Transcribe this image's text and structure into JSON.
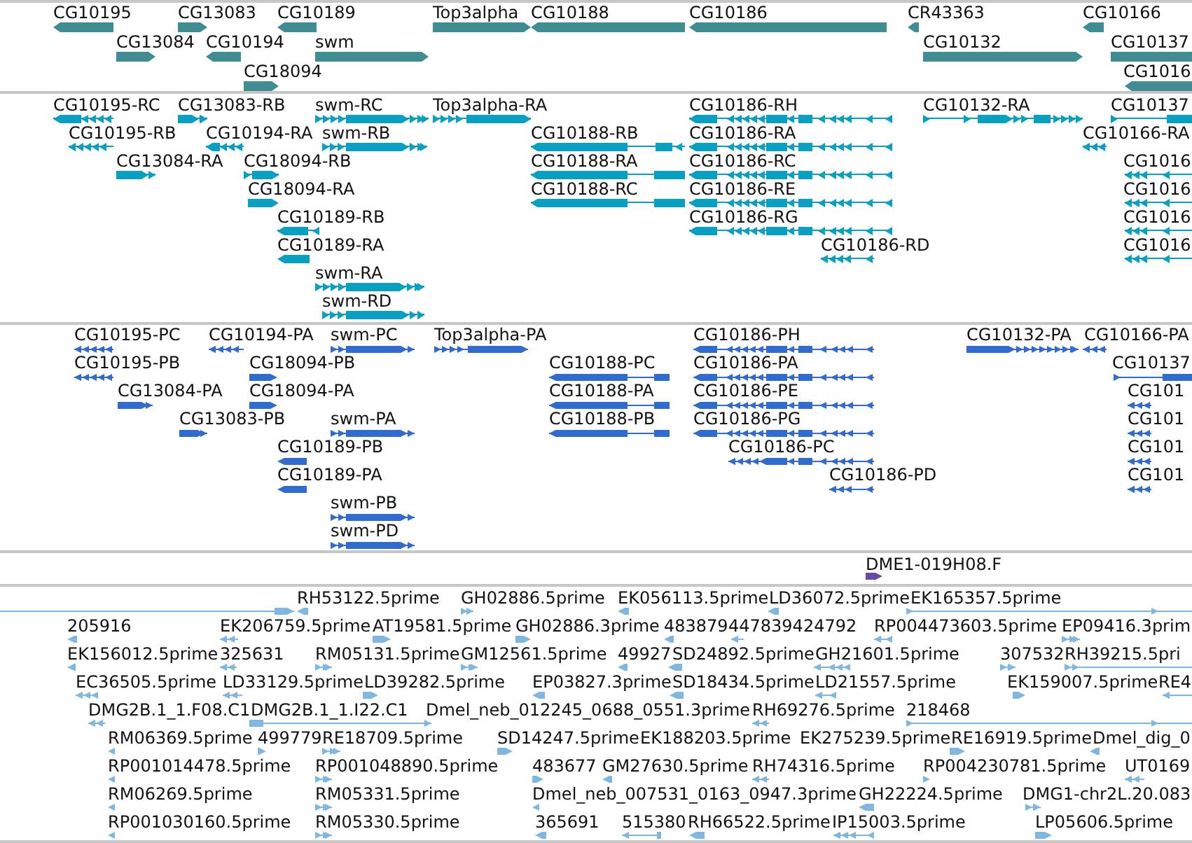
{
  "tracks": [
    {
      "kind": "gene",
      "color": "#3f8c92",
      "features": [
        {
          "label": "CG10195",
          "reverse": true
        },
        {
          "label": "CG13083",
          "reverse": false
        },
        {
          "label": "CG10189",
          "reverse": true
        },
        {
          "label": "Top3alpha",
          "reverse": false
        },
        {
          "label": "CG10188",
          "reverse": true
        },
        {
          "label": "CG10186",
          "reverse": true
        },
        {
          "label": "CR43363",
          "reverse": true
        },
        {
          "label": "CG10166",
          "reverse": true
        },
        {
          "label": "CG13084",
          "reverse": false
        },
        {
          "label": "CG10194",
          "reverse": true
        },
        {
          "label": "swm",
          "reverse": false
        },
        {
          "label": "CG10132",
          "reverse": false
        },
        {
          "label": "CG10137",
          "reverse": false
        },
        {
          "label": "CG18094",
          "reverse": false
        },
        {
          "label": "CG1016",
          "reverse": true
        }
      ]
    },
    {
      "kind": "transcript",
      "color": "#07a0c2",
      "features": [
        {
          "label": "CG10195-RC",
          "reverse": true
        },
        {
          "label": "CG13083-RB",
          "reverse": false
        },
        {
          "label": "swm-RC",
          "reverse": false
        },
        {
          "label": "Top3alpha-RA",
          "reverse": false
        },
        {
          "label": "CG10186-RH",
          "reverse": true
        },
        {
          "label": "CG10132-RA",
          "reverse": false
        },
        {
          "label": "CG10137",
          "reverse": false
        },
        {
          "label": "CG10195-RB",
          "reverse": true
        },
        {
          "label": "CG10194-RA",
          "reverse": true
        },
        {
          "label": "swm-RB",
          "reverse": false
        },
        {
          "label": "CG10188-RB",
          "reverse": true
        },
        {
          "label": "CG10186-RA",
          "reverse": true
        },
        {
          "label": "CG10166-RA",
          "reverse": true
        },
        {
          "label": "CG13084-RA",
          "reverse": false
        },
        {
          "label": "CG18094-RB",
          "reverse": false
        },
        {
          "label": "CG10188-RA",
          "reverse": true
        },
        {
          "label": "CG10186-RC",
          "reverse": true
        },
        {
          "label": "CG1016",
          "reverse": true
        },
        {
          "label": "CG18094-RA",
          "reverse": false
        },
        {
          "label": "CG10188-RC",
          "reverse": true
        },
        {
          "label": "CG10186-RE",
          "reverse": true
        },
        {
          "label": "CG1016",
          "reverse": true
        },
        {
          "label": "CG10189-RB",
          "reverse": true
        },
        {
          "label": "CG10186-RG",
          "reverse": true
        },
        {
          "label": "CG1016",
          "reverse": true
        },
        {
          "label": "CG10189-RA",
          "reverse": true
        },
        {
          "label": "CG10186-RD",
          "reverse": true
        },
        {
          "label": "CG1016",
          "reverse": true
        },
        {
          "label": "swm-RA",
          "reverse": false
        },
        {
          "label": "swm-RD",
          "reverse": false
        }
      ]
    },
    {
      "kind": "protein",
      "color": "#306bd0",
      "features": [
        {
          "label": "CG10195-PC",
          "reverse": true
        },
        {
          "label": "CG10194-PA",
          "reverse": true
        },
        {
          "label": "swm-PC",
          "reverse": false
        },
        {
          "label": "Top3alpha-PA",
          "reverse": false
        },
        {
          "label": "CG10186-PH",
          "reverse": true
        },
        {
          "label": "CG10132-PA",
          "reverse": false
        },
        {
          "label": "CG10166-PA",
          "reverse": true
        },
        {
          "label": "CG10195-PB",
          "reverse": true
        },
        {
          "label": "CG18094-PB",
          "reverse": false
        },
        {
          "label": "CG10188-PC",
          "reverse": true
        },
        {
          "label": "CG10186-PA",
          "reverse": true
        },
        {
          "label": "CG10137",
          "reverse": false
        },
        {
          "label": "CG13084-PA",
          "reverse": false
        },
        {
          "label": "CG18094-PA",
          "reverse": false
        },
        {
          "label": "CG10188-PA",
          "reverse": true
        },
        {
          "label": "CG10186-PE",
          "reverse": true
        },
        {
          "label": "CG101",
          "reverse": true
        },
        {
          "label": "CG13083-PB",
          "reverse": false
        },
        {
          "label": "swm-PA",
          "reverse": false
        },
        {
          "label": "CG10188-PB",
          "reverse": true
        },
        {
          "label": "CG10186-PG",
          "reverse": true
        },
        {
          "label": "CG101",
          "reverse": true
        },
        {
          "label": "CG10189-PB",
          "reverse": true
        },
        {
          "label": "CG10186-PC",
          "reverse": true
        },
        {
          "label": "CG101",
          "reverse": true
        },
        {
          "label": "CG10189-PA",
          "reverse": true
        },
        {
          "label": "CG10186-PD",
          "reverse": true
        },
        {
          "label": "CG101",
          "reverse": true
        },
        {
          "label": "swm-PB",
          "reverse": false
        },
        {
          "label": "swm-PD",
          "reverse": false
        }
      ]
    },
    {
      "kind": "clone",
      "color": "#6a4aa8",
      "features": [
        {
          "label": "DME1-019H08.F",
          "reverse": false
        }
      ]
    },
    {
      "kind": "est",
      "color": "#7db7e2",
      "features": [
        {
          "reverse": false
        },
        {
          "label": "RH53122.5prime",
          "reverse": true
        },
        {
          "label": "GH02886.5prime",
          "reverse": false
        },
        {
          "label": "EK056113.5prime",
          "reverse": true
        },
        {
          "label": "LD36072.5prime",
          "reverse": true
        },
        {
          "label": "EK165357.5prime",
          "reverse": false
        },
        {
          "label": "205916",
          "reverse": true
        },
        {
          "label": "EK206759.5prime",
          "reverse": true
        },
        {
          "label": "AT19581.5prime",
          "reverse": false
        },
        {
          "label": "GH02886.3prime",
          "reverse": false
        },
        {
          "label": "483879",
          "reverse": true
        },
        {
          "label": "447839424792",
          "reverse": true
        },
        {
          "label": "RP004473603.5prime",
          "reverse": true
        },
        {
          "label": "EP09416.3prim",
          "reverse": false
        },
        {
          "label": "EK156012.5prime",
          "reverse": true
        },
        {
          "label": "325631",
          "reverse": true
        },
        {
          "label": "RM05131.5prime",
          "reverse": false
        },
        {
          "label": "GM12561.5prime",
          "reverse": false
        },
        {
          "label": "49927",
          "reverse": true
        },
        {
          "label": "SD24892.5prime",
          "reverse": true
        },
        {
          "label": "GH21601.5prime",
          "reverse": true
        },
        {
          "label": "307532",
          "reverse": false
        },
        {
          "label": "RH39215.5pri",
          "reverse": false
        },
        {
          "label": "EC36505.5prime",
          "reverse": true
        },
        {
          "label": "LD33129.5prime",
          "reverse": true
        },
        {
          "label": "LD39282.5prime",
          "reverse": false
        },
        {
          "label": "EP03827.3prime",
          "reverse": true
        },
        {
          "label": "SD18434.5prime",
          "reverse": true
        },
        {
          "label": "LD21557.5prime",
          "reverse": true
        },
        {
          "label": "EK159007.5prime",
          "reverse": false
        },
        {
          "label": "RE4",
          "reverse": true
        },
        {
          "label": "DMG2B.1_1.F08.C1",
          "reverse": true
        },
        {
          "label": "DMG2B.1_1.I22.C1",
          "reverse": false
        },
        {
          "label": "Dmel_neb_012245_0688_0551.3prime"
        },
        {
          "label": "RH69276.5prime",
          "reverse": true
        },
        {
          "label": "218468",
          "reverse": false
        },
        {
          "label": "RM06369.5prime",
          "reverse": true
        },
        {
          "label": "499779",
          "reverse": false
        },
        {
          "label": "RE18709.5prime",
          "reverse": false
        },
        {
          "label": "SD14247.5prime",
          "reverse": false
        },
        {
          "label": "EK188203.5prime"
        },
        {
          "label": "EK275239.5prime"
        },
        {
          "label": "RE16919.5prime",
          "reverse": false
        },
        {
          "label": "Dmel_dig_0",
          "reverse": true
        },
        {
          "label": "RP001014478.5prime",
          "reverse": true
        },
        {
          "label": "RP001048890.5prime",
          "reverse": false
        },
        {
          "label": "483677",
          "reverse": false
        },
        {
          "label": "GM27630.5prime",
          "reverse": true
        },
        {
          "label": "RH74316.5prime",
          "reverse": true
        },
        {
          "label": "RP004230781.5prime",
          "reverse": false
        },
        {
          "label": "UT0169",
          "reverse": true
        },
        {
          "label": "RM06269.5prime",
          "reverse": true
        },
        {
          "label": "RM05331.5prime",
          "reverse": false
        },
        {
          "label": "Dmel_neb_007531_0163_0947.3prime",
          "reverse": true
        },
        {
          "label": "GH22224.5prime",
          "reverse": true
        },
        {
          "label": "DMG1-chr2L.20.083",
          "reverse": false
        },
        {
          "label": "RP001030160.5prime",
          "reverse": true
        },
        {
          "label": "RM05330.5prime",
          "reverse": false
        },
        {
          "label": "365691",
          "reverse": true
        },
        {
          "label": "515380",
          "reverse": true
        },
        {
          "label": "RH66522.5prime",
          "reverse": true
        },
        {
          "label": "IP15003.5prime",
          "reverse": true
        },
        {
          "label": "LP05606.5prime",
          "reverse": false
        }
      ]
    }
  ]
}
